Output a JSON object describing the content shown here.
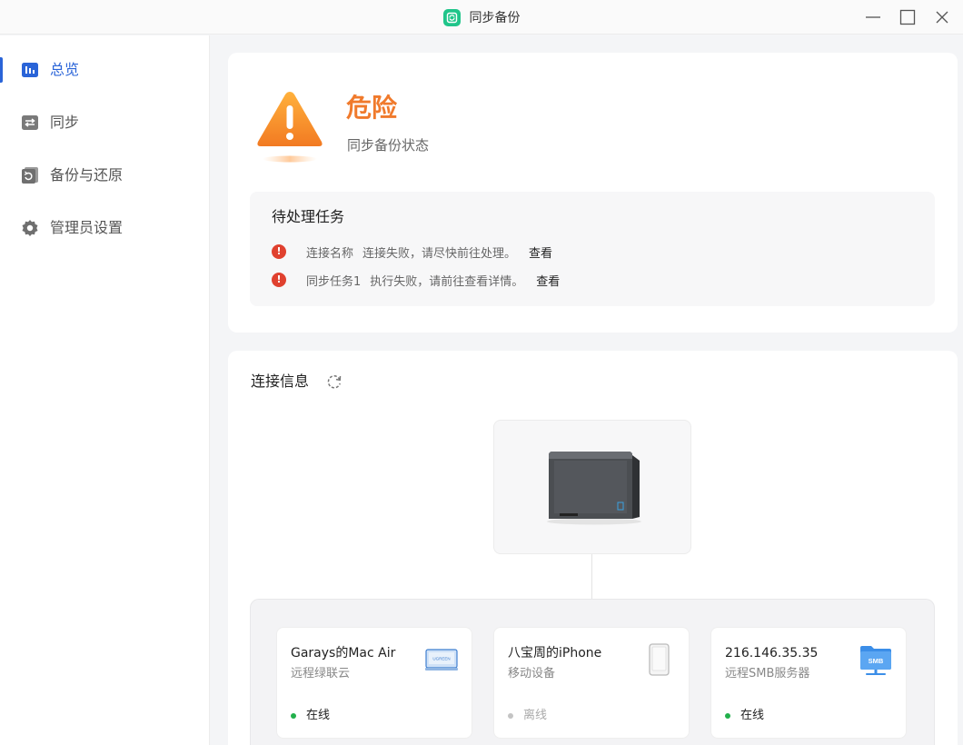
{
  "window": {
    "title": "同步备份",
    "logo_icon": "sync-backup-logo-icon",
    "controls": [
      "minimize-icon",
      "maximize-icon",
      "close-icon"
    ]
  },
  "sidebar": {
    "items": [
      {
        "label": "总览",
        "icon": "chart-icon",
        "active": true
      },
      {
        "label": "同步",
        "icon": "sync-arrows-icon",
        "active": false
      },
      {
        "label": "备份与还原",
        "icon": "backup-restore-icon",
        "active": false
      },
      {
        "label": "管理员设置",
        "icon": "gear-icon",
        "active": false
      }
    ]
  },
  "status": {
    "level": "危险",
    "subtitle": "同步备份状态",
    "icon": "warning-triangle-icon"
  },
  "pending_tasks": {
    "title": "待处理任务",
    "items": [
      {
        "name": "连接名称",
        "message": "连接失败，请尽快前往处理。",
        "link": "查看"
      },
      {
        "name": "同步任务1",
        "message": "执行失败，请前往查看详情。",
        "link": "查看"
      }
    ]
  },
  "connection": {
    "title": "连接信息",
    "refresh_icon": "refresh-icon",
    "nas_icon": "nas-device-image",
    "devices": [
      {
        "name": "Garays的Mac Air",
        "type": "远程绿联云",
        "status": "在线",
        "online": true,
        "icon": "laptop-icon"
      },
      {
        "name": "八宝周的iPhone",
        "type": "移动设备",
        "status": "离线",
        "online": false,
        "icon": "phone-icon"
      },
      {
        "name": "216.146.35.35",
        "type": "远程SMB服务器",
        "status": "在线",
        "online": true,
        "icon": "smb-folder-icon"
      }
    ]
  },
  "colors": {
    "accent": "#2a64d8",
    "danger": "#f07a2c",
    "error": "#e0412f",
    "online": "#22b04b",
    "offline": "#c4c4c4"
  }
}
